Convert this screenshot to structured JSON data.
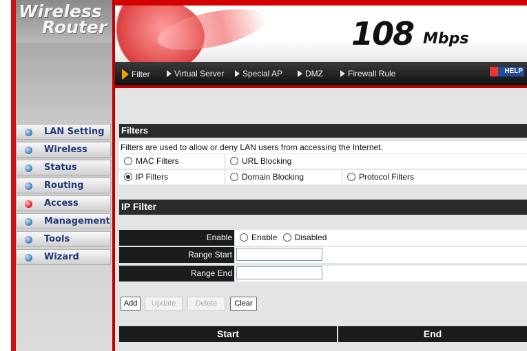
{
  "logo": {
    "line1": "Wireless",
    "line2": "Router"
  },
  "banner": {
    "speed": "108",
    "speed_unit": "Mbps"
  },
  "nav": {
    "items": [
      {
        "label": "Filter",
        "active": true
      },
      {
        "label": "Virtual Server"
      },
      {
        "label": "Special AP"
      },
      {
        "label": "DMZ"
      },
      {
        "label": "Firewall Rule"
      }
    ],
    "help": "HELP"
  },
  "sidebar": {
    "items": [
      {
        "label": "LAN Setting"
      },
      {
        "label": "Wireless"
      },
      {
        "label": "Status"
      },
      {
        "label": "Routing"
      },
      {
        "label": "Access",
        "active": true
      },
      {
        "label": "Management"
      },
      {
        "label": "Tools"
      },
      {
        "label": "Wizard"
      }
    ]
  },
  "filters": {
    "title": "Filters",
    "description": "Filters are used to allow or deny LAN users from accessing the Internet.",
    "options": {
      "mac": "MAC Filters",
      "url": "URL Blocking",
      "ip": "IP Filters",
      "domain": "Domain Blocking",
      "protocol": "Protocol Filters"
    },
    "selected": "IP Filters"
  },
  "ip_filter": {
    "title": "IP Filter",
    "enable_label": "Enable",
    "enable_option": "Enable",
    "disabled_option": "Disabled",
    "range_start_label": "Range Start",
    "range_start_value": "",
    "range_end_label": "Range End",
    "range_end_value": ""
  },
  "buttons": {
    "add": "Add",
    "update": "Update",
    "delete": "Delete",
    "clear": "Clear"
  },
  "table": {
    "col_start": "Start",
    "col_end": "End"
  },
  "colors": {
    "accent_red": "#cc1010",
    "header_dark": "#1c1c1c",
    "menu_text": "#1e3a7a"
  }
}
